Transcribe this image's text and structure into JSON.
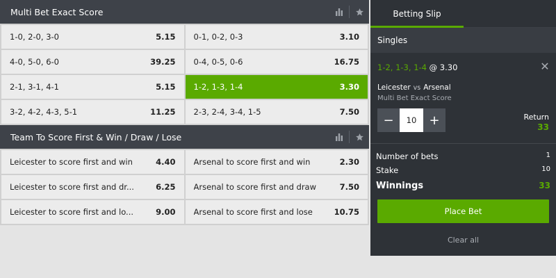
{
  "markets": [
    {
      "title": "Multi Bet Exact Score",
      "rows": [
        [
          {
            "label": "1-0, 2-0, 3-0",
            "odds": "5.15"
          },
          {
            "label": "0-1, 0-2, 0-3",
            "odds": "3.10"
          }
        ],
        [
          {
            "label": "4-0, 5-0, 6-0",
            "odds": "39.25"
          },
          {
            "label": "0-4, 0-5, 0-6",
            "odds": "16.75"
          }
        ],
        [
          {
            "label": "2-1, 3-1, 4-1",
            "odds": "5.15"
          },
          {
            "label": "1-2, 1-3, 1-4",
            "odds": "3.30"
          }
        ],
        [
          {
            "label": "3-2, 4-2, 4-3, 5-1",
            "odds": "11.25"
          },
          {
            "label": "2-3, 2-4, 3-4, 1-5",
            "odds": "7.50"
          }
        ]
      ]
    },
    {
      "title": "Team To Score First & Win / Draw / Lose",
      "rows": [
        [
          {
            "label": "Leicester to score first and win",
            "odds": "4.40"
          },
          {
            "label": "Arsenal to score first and win",
            "odds": "2.30"
          }
        ],
        [
          {
            "label": "Leicester to score first and dr...",
            "odds": "6.25"
          },
          {
            "label": "Arsenal to score first and draw",
            "odds": "7.50"
          }
        ],
        [
          {
            "label": "Leicester to score first and lo...",
            "odds": "9.00"
          },
          {
            "label": "Arsenal to score first and lose",
            "odds": "10.75"
          }
        ]
      ]
    }
  ],
  "icons": {
    "stats": "bar-chart-icon",
    "favourite": "star-icon",
    "close": "close-icon",
    "minus": "minus-icon",
    "plus": "plus-icon"
  },
  "colors": {
    "accent": "#5aaa00",
    "header": "#3e4249",
    "slip_bg": "#2e3237"
  },
  "slip": {
    "tab": "Betting Slip",
    "section": "Singles",
    "selection": "1-2, 1-3, 1-4",
    "at": "@",
    "odds": "3.30",
    "home": "Leicester",
    "vs": "vs",
    "away": "Arsenal",
    "market": "Multi Bet Exact Score",
    "stake": "10",
    "minus": "−",
    "plus": "+",
    "return_label": "Return",
    "return_value": "33",
    "num_bets_label": "Number of bets",
    "num_bets": "1",
    "stake_label": "Stake",
    "stake_value": "10",
    "winnings_label": "Winnings",
    "winnings_value": "33",
    "place_bet": "Place Bet",
    "clear_all": "Clear all"
  }
}
